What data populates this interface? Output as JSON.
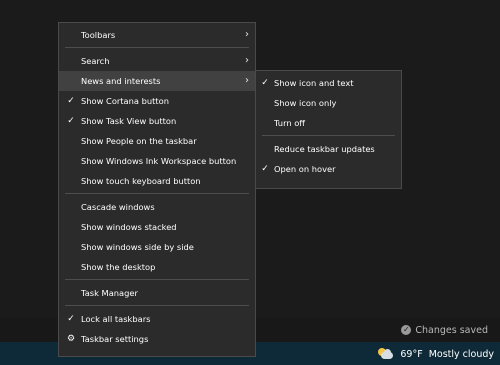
{
  "context_menu": {
    "items": [
      {
        "label": "Toolbars",
        "checked": false,
        "submenu": true
      },
      {
        "label": "Search",
        "checked": false,
        "submenu": true
      },
      {
        "label": "News and interests",
        "checked": false,
        "submenu": true,
        "highlighted": true
      },
      {
        "label": "Show Cortana button",
        "checked": true
      },
      {
        "label": "Show Task View button",
        "checked": true
      },
      {
        "label": "Show People on the taskbar",
        "checked": false
      },
      {
        "label": "Show Windows Ink Workspace button",
        "checked": false
      },
      {
        "label": "Show touch keyboard button",
        "checked": false
      },
      {
        "label": "Cascade windows"
      },
      {
        "label": "Show windows stacked"
      },
      {
        "label": "Show windows side by side"
      },
      {
        "label": "Show the desktop"
      },
      {
        "label": "Task Manager"
      },
      {
        "label": "Lock all taskbars",
        "checked": true
      },
      {
        "label": "Taskbar settings",
        "icon": "gear-icon"
      }
    ],
    "check_glyph": "✓",
    "arrow_glyph": "›",
    "gear_glyph": "⚙"
  },
  "news_submenu": {
    "items": [
      {
        "label": "Show icon and text",
        "checked": true
      },
      {
        "label": "Show icon only",
        "checked": false
      },
      {
        "label": "Turn off",
        "checked": false
      },
      {
        "label": "Reduce taskbar updates",
        "checked": false
      },
      {
        "label": "Open on hover",
        "checked": true
      }
    ]
  },
  "status": {
    "saved_text": "Changes saved",
    "saved_icon": "checkmark-circle-icon"
  },
  "taskbar": {
    "weather_temp": "69°F",
    "weather_condition": "Mostly cloudy",
    "weather_icon": "partly-cloudy-icon"
  },
  "colors": {
    "menu_bg": "#2b2b2b",
    "menu_highlight": "#414141",
    "taskbar_bg": "#0e2a38"
  }
}
